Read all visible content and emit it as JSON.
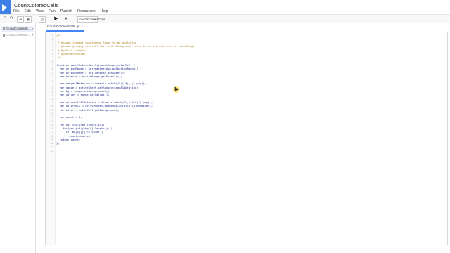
{
  "app": {
    "title": "CountColoredCells"
  },
  "menu": [
    "File",
    "Edit",
    "View",
    "Run",
    "Publish",
    "Resources",
    "Help"
  ],
  "toolbar": {
    "function_select": "countColoredCells"
  },
  "sidebar": {
    "files": [
      {
        "name": "CountColoredC...",
        "active": true
      },
      {
        "name": "CountColoredC...",
        "active": false
      }
    ]
  },
  "editor": {
    "tab": "CountColoredCells.gs",
    "lines": [
      {
        "t": "c",
        "text": "/**"
      },
      {
        "t": "c",
        "text": " *"
      },
      {
        "t": "c",
        "text": " * @param {range} countRange Range to be evaluated"
      },
      {
        "t": "c",
        "text": " * @param {range} colorRef Cell with background color to be searched for in countRange"
      },
      {
        "t": "c",
        "text": " * @return {number}"
      },
      {
        "t": "c",
        "text": " * @customfunction"
      },
      {
        "t": "c",
        "text": " */"
      },
      {
        "t": "n",
        "text": ""
      },
      {
        "t": "d",
        "text": "function countColoredCells(countRange,colorRef) {"
      },
      {
        "t": "d",
        "text": "  var activeRange = SpreadsheetApp.getActiveRange();"
      },
      {
        "t": "d",
        "text": "  var activeSheet = activeRange.getSheet();"
      },
      {
        "t": "d",
        "text": "  var formula = activeRange.getFormula();"
      },
      {
        "t": "n",
        "text": ""
      },
      {
        "t": "d",
        "text": "  var rangeA1Notation = formula.match(/\\((.*)\\,/).pop();"
      },
      {
        "t": "d",
        "text": "  var range = activeSheet.getRange(rangeA1Notation);"
      },
      {
        "t": "d",
        "text": "  var bg = range.getBackgrounds();"
      },
      {
        "t": "d",
        "text": "  var values = range.getValues();"
      },
      {
        "t": "n",
        "text": ""
      },
      {
        "t": "d",
        "text": "  var colorCellA1Notation = formula.match(/\\,(.*)\\)/).pop();"
      },
      {
        "t": "d",
        "text": "  var colorCell = activeSheet.getRange(colorCellA1Notation);"
      },
      {
        "t": "d",
        "text": "  var color = colorCell.getBackground();"
      },
      {
        "t": "n",
        "text": ""
      },
      {
        "t": "d",
        "text": "  var count = 0;"
      },
      {
        "t": "n",
        "text": ""
      },
      {
        "t": "d",
        "text": "  for(var i=0;i<bg.length;i++)"
      },
      {
        "t": "d",
        "text": "    for(var j=0;j<bg[0].length;j++)"
      },
      {
        "t": "d",
        "text": "      if( bg[i][j] == color )"
      },
      {
        "t": "d",
        "text": "        count=count+1;"
      },
      {
        "t": "d",
        "text": "  return count;"
      },
      {
        "t": "d",
        "text": "};"
      },
      {
        "t": "n",
        "text": ""
      },
      {
        "t": "n",
        "text": ""
      }
    ]
  },
  "colors": {
    "accent": "#4285f4",
    "logo": "#3f80e7",
    "comment": "#ae7f1a",
    "code": "#1f2a8a"
  }
}
